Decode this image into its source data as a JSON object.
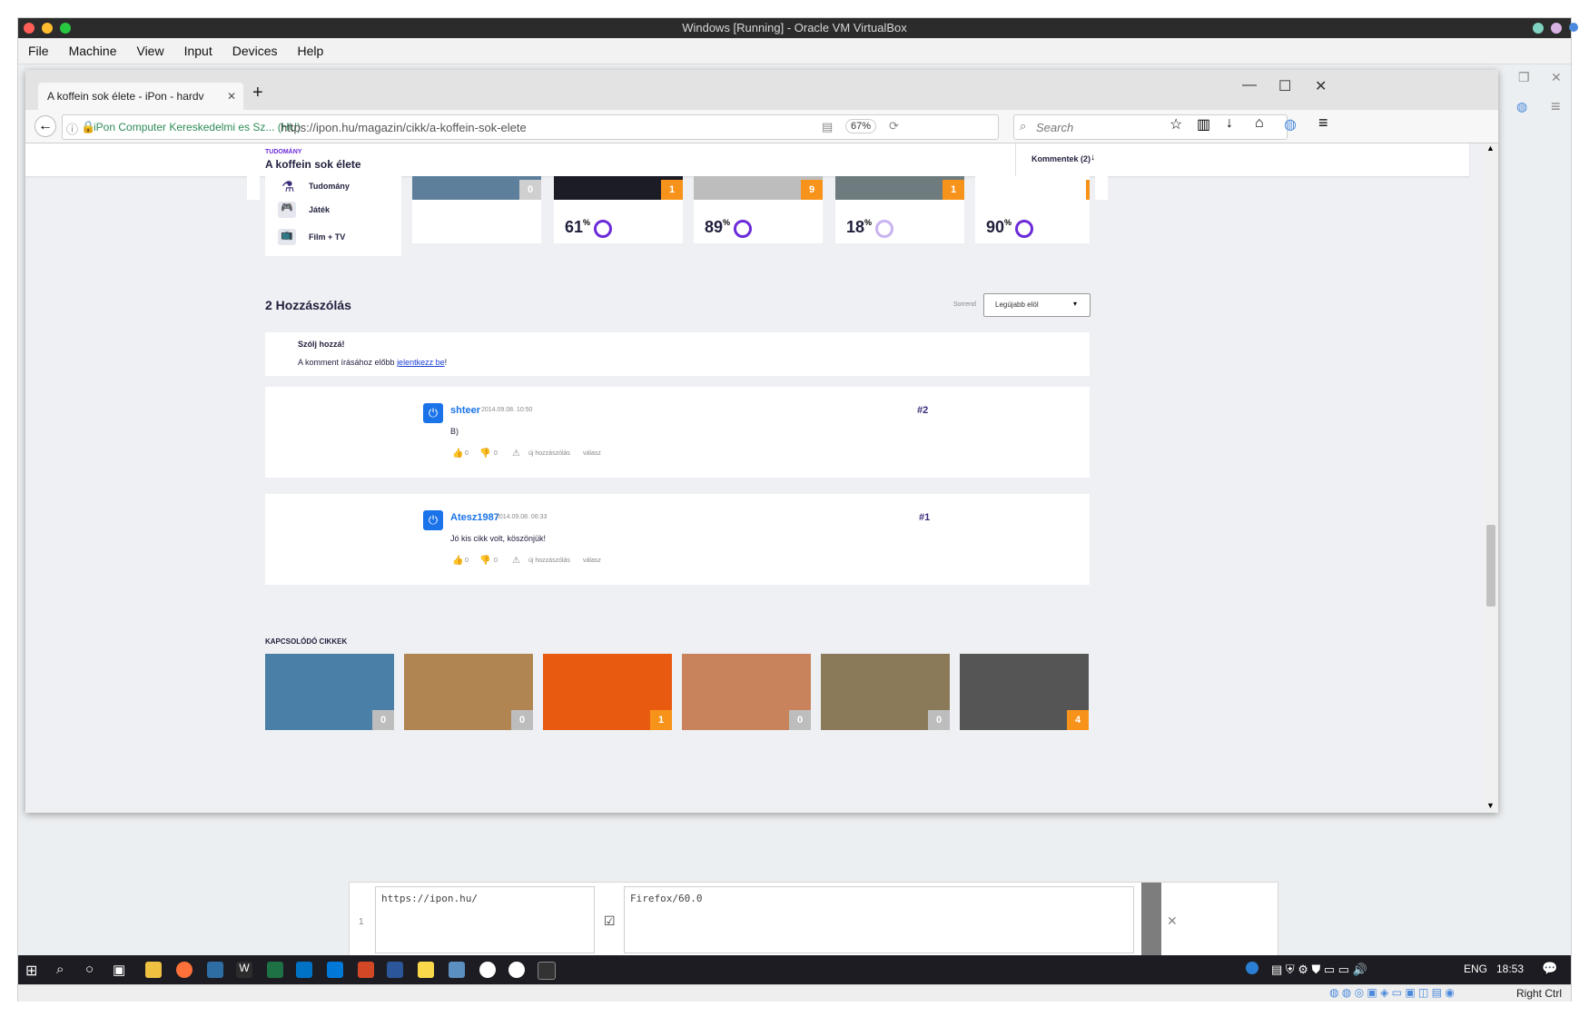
{
  "host": {
    "title": "Windows [Running] - Oracle VM VirtualBox",
    "menu": [
      "File",
      "Machine",
      "View",
      "Input",
      "Devices",
      "Help"
    ]
  },
  "firefox": {
    "tab_title": "A koffein sok élete - iPon - hardv",
    "new_tab": "+",
    "url_identity": "iPon Computer Kereskedelmi es Sz...  (HU)",
    "url": "https://ipon.hu/magazin/cikk/a-koffein-sok-elete",
    "zoom": "67%",
    "search_placeholder": "Search"
  },
  "page": {
    "category": "TUDOMÁNY",
    "article_title": "A koffein sok élete",
    "comments_link": "Kommentek (2)",
    "sidebar": [
      {
        "label": "Tudomány",
        "icon": "flask-icon"
      },
      {
        "label": "Játék",
        "icon": "gamepad-icon"
      },
      {
        "label": "Film + TV",
        "icon": "tv-icon"
      }
    ],
    "top_cards": [
      {
        "badge": "0",
        "pct": null
      },
      {
        "badge": "1",
        "pct": "61"
      },
      {
        "badge": "9",
        "pct": "89"
      },
      {
        "badge": "1",
        "pct": "18"
      },
      {
        "badge": "",
        "pct": "90"
      }
    ],
    "pct_sign": "%",
    "comments_heading": "2 Hozzászólás",
    "sort_label": "Sorrend",
    "sort_value": "Legújabb elöl",
    "join_heading": "Szólj hozzá!",
    "join_text": "A komment írásához előbb ",
    "join_link": "jelentkezz be",
    "join_end": "!",
    "comments": [
      {
        "user": "shteer",
        "date": "2014.09.08. 10:50",
        "num": "#2",
        "text": "B)",
        "likes": "0",
        "dislikes": "0",
        "new": "új hozzászólás",
        "reply": "válasz"
      },
      {
        "user": "Atesz1987",
        "date": "2014.09.08. 06:33",
        "num": "#1",
        "text": "Jó kis cikk volt, köszönjük!",
        "likes": "0",
        "dislikes": "0",
        "new": "új hozzászólás",
        "reply": "válasz"
      }
    ],
    "related_heading": "KAPCSOLÓDÓ CIKKEK",
    "related": [
      {
        "badge": "0",
        "color": "#4a7fa8"
      },
      {
        "badge": "0",
        "color": "#b08552"
      },
      {
        "badge": "1",
        "color": "#e85a10"
      },
      {
        "badge": "0",
        "color": "#c8825c"
      },
      {
        "badge": "0",
        "color": "#8a7a5a"
      },
      {
        "badge": "4",
        "color": "#555555"
      }
    ]
  },
  "bottom_panel": {
    "row_num": "1",
    "url_value": "https://ipon.hu/",
    "ua_value": "Firefox/60.0"
  },
  "taskbar": {
    "lang": "ENG",
    "time": "18:53",
    "right_ctrl": "Right Ctrl"
  },
  "colors": {
    "accent": "#6c2bd9",
    "orange": "#f7931a",
    "link": "#1a73e8"
  }
}
